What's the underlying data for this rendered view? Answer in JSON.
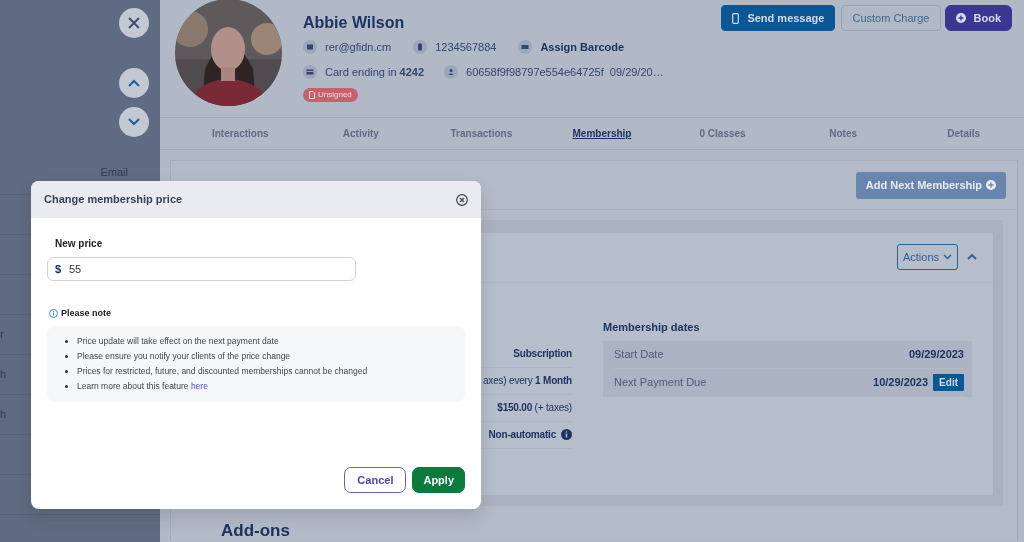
{
  "left_panel": {
    "column_header": "Email",
    "rows": [
      "",
      "",
      "",
      "r",
      "h",
      "h",
      "",
      ""
    ]
  },
  "profile": {
    "name": "Abbie Wilson",
    "email": "rer@gfidn.cm",
    "phone": "1234567884",
    "barcode_link": "Assign Barcode",
    "card": "Card ending in **4242**",
    "member_id": "60658f9f98797e554e64725f  09/29/20…",
    "badge": "Unsigned"
  },
  "actions": [
    {
      "kind": "primary",
      "label": "Send message"
    },
    {
      "kind": "outline",
      "label": "Custom Charge"
    },
    {
      "kind": "book",
      "label": "Book"
    }
  ],
  "tabs": [
    {
      "label": "Interactions",
      "selected": false
    },
    {
      "label": "Activity",
      "selected": false
    },
    {
      "label": "Transactions",
      "selected": false
    },
    {
      "label": "Membership",
      "selected": true
    },
    {
      "label": "0 Classes",
      "selected": false
    },
    {
      "label": "Notes",
      "selected": false
    },
    {
      "label": "Details",
      "selected": false
    }
  ],
  "membership": {
    "add_button": "Add Next Membership",
    "actions_button": "Actions",
    "details": [
      {
        "kind": "plain",
        "value": "Subscription"
      },
      {
        "kind": "plain",
        "value": "axes) every **1 Month**"
      },
      {
        "kind": "plain",
        "value": "**$150.00** (+ taxes)"
      },
      {
        "kind": "info",
        "value": "Non-automatic"
      }
    ],
    "dates": {
      "title": "Membership dates",
      "rows": [
        {
          "label": "Start Date",
          "value": "09/29/2023"
        },
        {
          "label": "Next Payment Due",
          "value": "10/29/2023",
          "action": "Edit"
        }
      ]
    }
  },
  "add_ons_title": "Add-ons",
  "dialog": {
    "title": "Change membership price",
    "field_label": "New price",
    "currency": "$",
    "value": "55",
    "note_title": "Please note",
    "notes": [
      "Price update will take effect on the next payment date",
      "Please ensure you notify your clients of the price change",
      "Prices for restricted, future, and discounted memberships cannot be changed",
      "Learn more about this feature "
    ],
    "note_link": "here",
    "buttons": [
      {
        "kind": "cancel",
        "label": "Cancel"
      },
      {
        "kind": "apply",
        "label": "Apply"
      }
    ]
  }
}
